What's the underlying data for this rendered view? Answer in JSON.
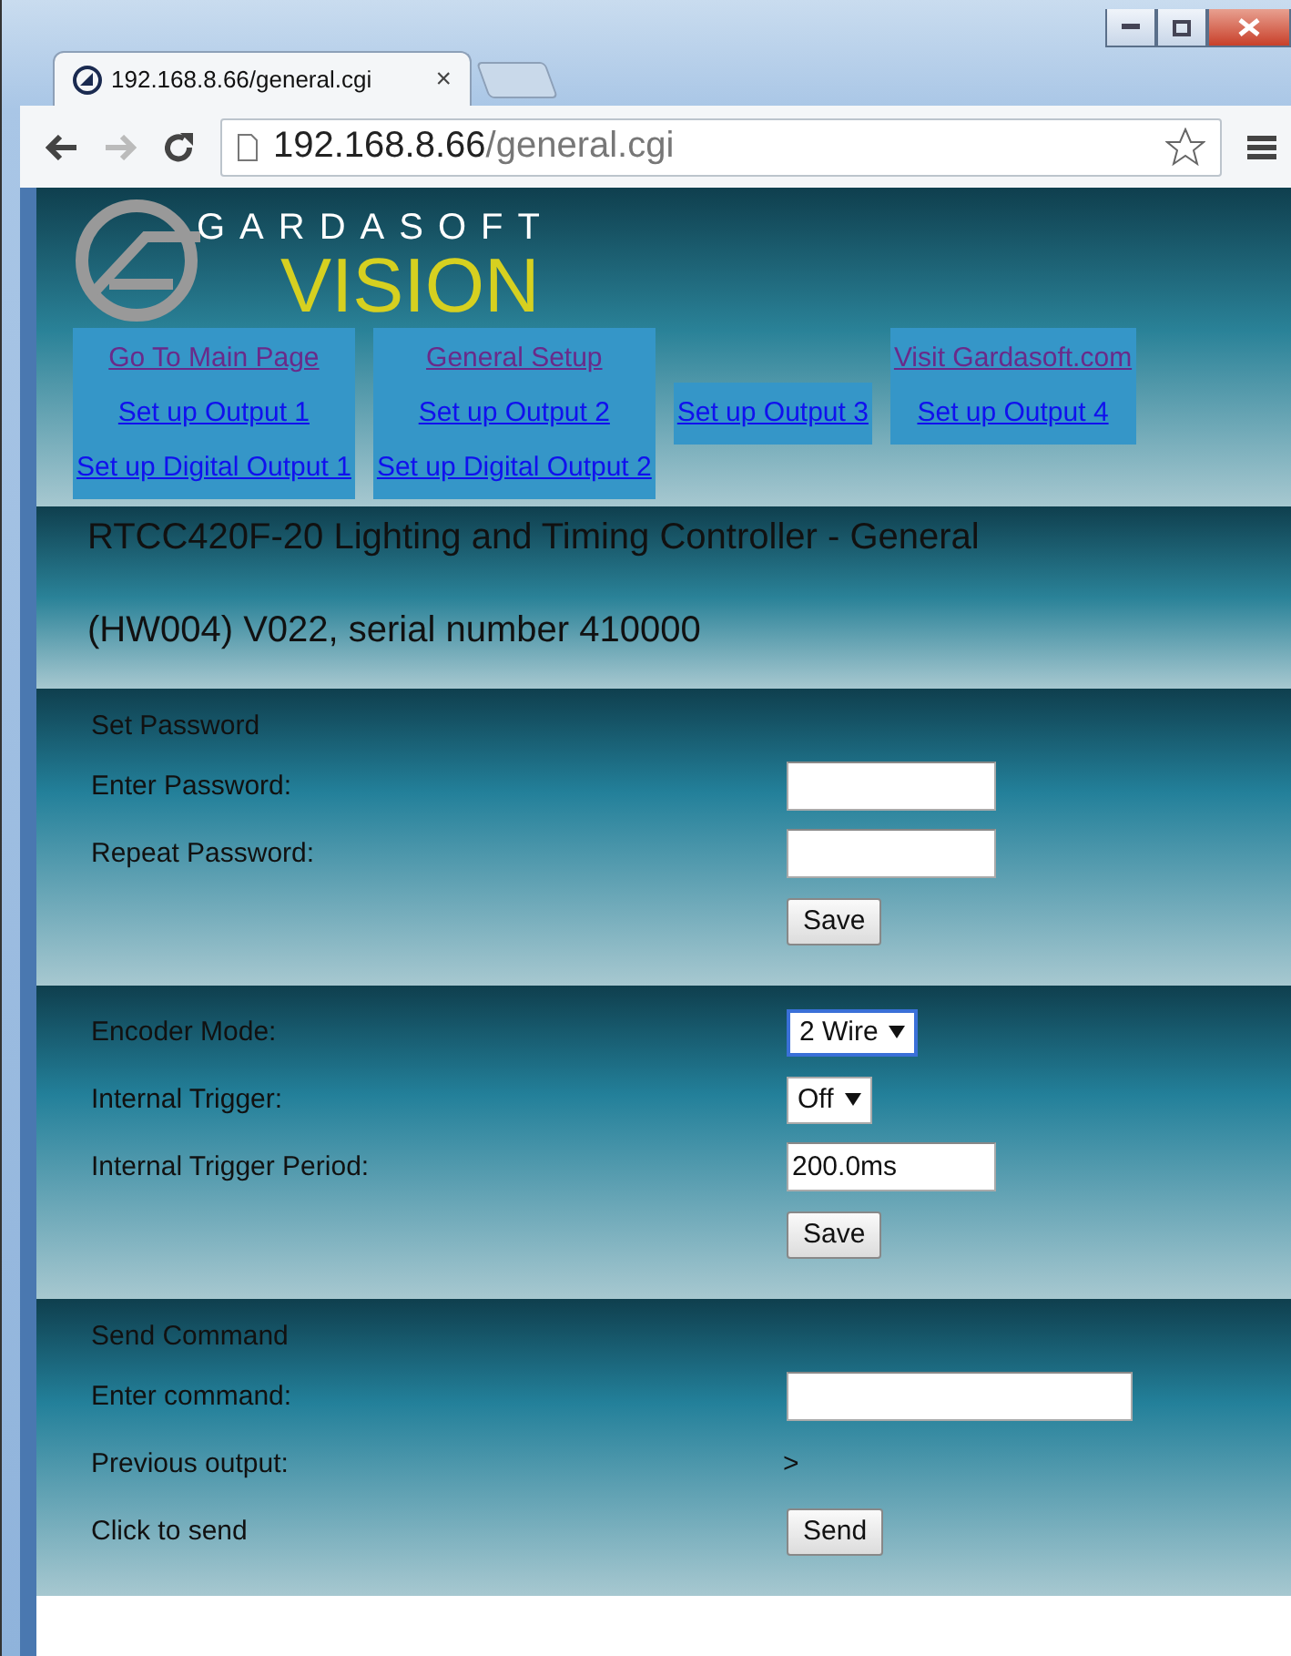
{
  "browser": {
    "tab": {
      "title": "192.168.8.66/general.cgi",
      "close": "×"
    },
    "address": {
      "host": "192.168.8.66",
      "path": "/general.cgi"
    }
  },
  "logo": {
    "top": "GARDASOFT",
    "bottom": "VISION"
  },
  "nav": [
    {
      "links": [
        {
          "label": "Go To Main Page",
          "visited": true
        },
        {
          "label": "Set up Output 1",
          "visited": false
        },
        {
          "label": "Set up Digital Output 1",
          "visited": false
        }
      ]
    },
    {
      "links": [
        {
          "label": "General Setup",
          "visited": true
        },
        {
          "label": "Set up Output 2",
          "visited": false
        },
        {
          "label": "Set up Digital Output 2",
          "visited": false
        }
      ]
    },
    {
      "links": [
        {
          "label": "Set up Output 3",
          "visited": false
        }
      ]
    },
    {
      "links": [
        {
          "label": "Visit Gardasoft.com",
          "visited": true
        },
        {
          "label": "Set up Output 4",
          "visited": false
        }
      ]
    }
  ],
  "heading": [
    "RTCC420F-20 Lighting and Timing Controller - General",
    "(HW004) V022, serial number 410000"
  ],
  "sections": [
    {
      "title": "Set Password",
      "rows": [
        {
          "label": "Enter Password:",
          "control": {
            "kind": "field",
            "wide": false
          }
        },
        {
          "label": "Repeat Password:",
          "control": {
            "kind": "field",
            "wide": false
          }
        },
        {
          "control": {
            "kind": "button",
            "label": "Save"
          }
        }
      ]
    },
    {
      "rows": [
        {
          "label": "Encoder Mode:",
          "control": {
            "kind": "select",
            "value": "2 Wire",
            "focused": true
          }
        },
        {
          "label": "Internal Trigger:",
          "control": {
            "kind": "select",
            "value": "Off",
            "focused": false
          }
        },
        {
          "label": "Internal Trigger Period:",
          "control": {
            "kind": "field",
            "value": "200.0ms",
            "wide": false
          }
        },
        {
          "control": {
            "kind": "button",
            "label": "Save"
          }
        }
      ]
    },
    {
      "title": "Send Command",
      "rows": [
        {
          "label": "Enter command:",
          "control": {
            "kind": "field",
            "wide": true
          }
        },
        {
          "label": "Previous output:",
          "control": {
            "kind": "text",
            "value": ">"
          }
        },
        {
          "label": "Click to send",
          "control": {
            "kind": "button",
            "label": "Send"
          }
        }
      ]
    }
  ]
}
